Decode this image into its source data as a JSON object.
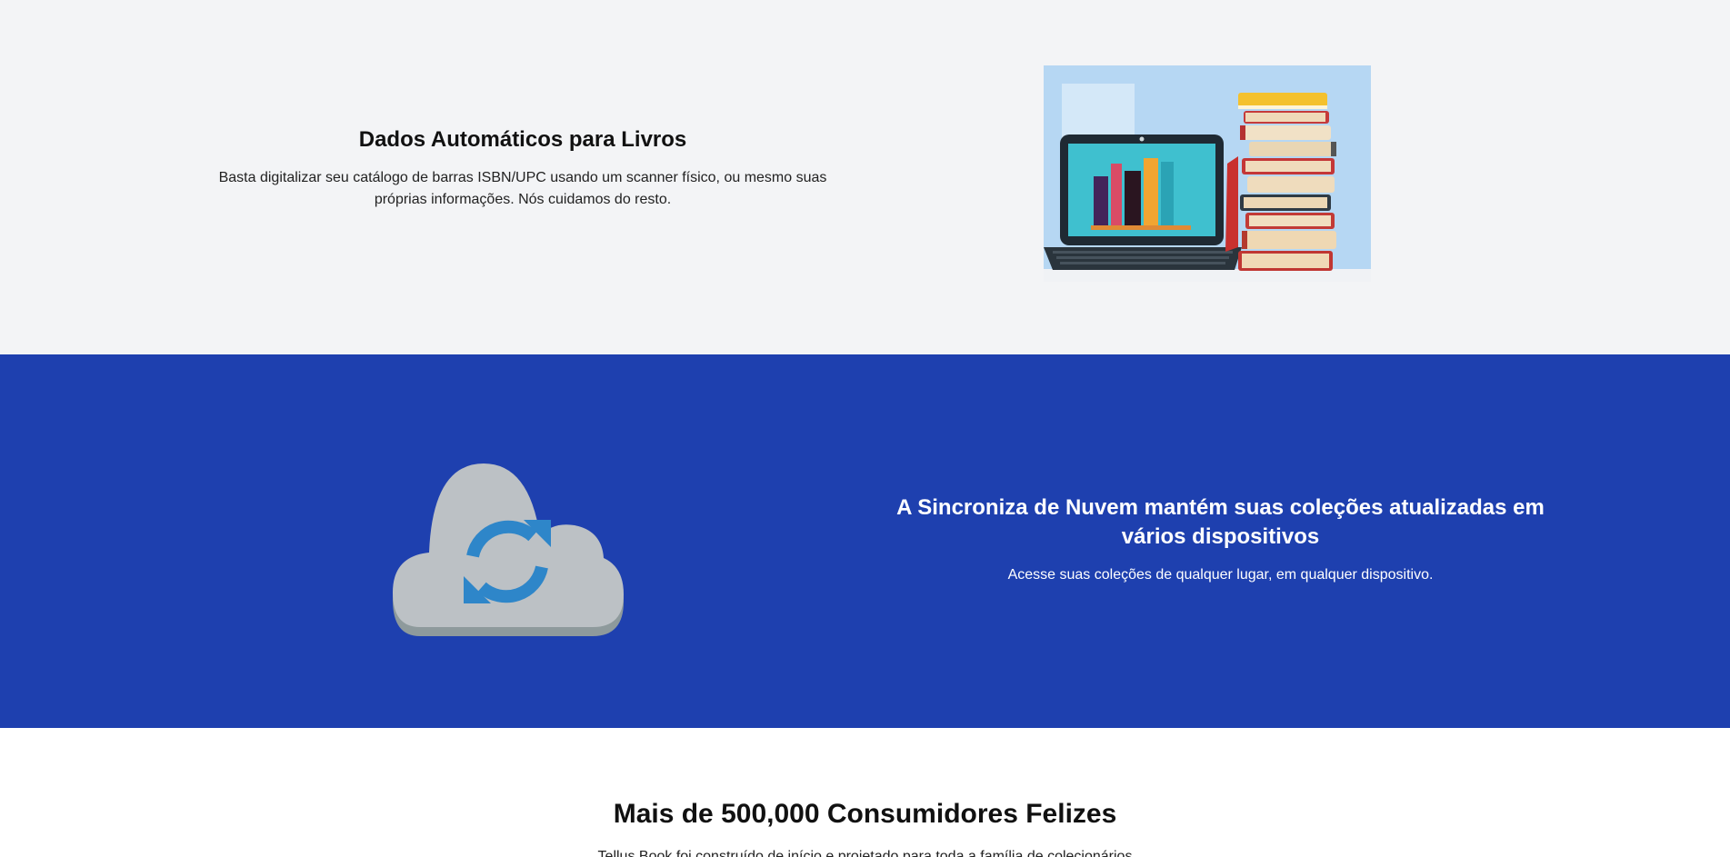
{
  "books_section": {
    "title": "Dados Automáticos para Livros",
    "description": "Basta digitalizar seu catálogo de barras ISBN/UPC usando um scanner físico, ou mesmo suas próprias informações. Nós cuidamos do resto.",
    "image_icon": "laptop-books-illustration",
    "background": "#f3f4f6"
  },
  "cloud_section": {
    "title": "A Sincroniza de Nuvem mantém suas coleções atualizadas em vários dispositivos",
    "description": "Acesse suas coleções de qualquer lugar, em qualquer dispositivo.",
    "image_icon": "cloud-sync-icon",
    "background": "#1e40af",
    "icon_color": "#2e86c9",
    "cloud_color": "#bcc1c5"
  },
  "consumers_section": {
    "title": "Mais de 500,000 Consumidores Felizes",
    "subtitle": "Tellus Book foi construído de início e projetado para toda a família de colecionários"
  }
}
